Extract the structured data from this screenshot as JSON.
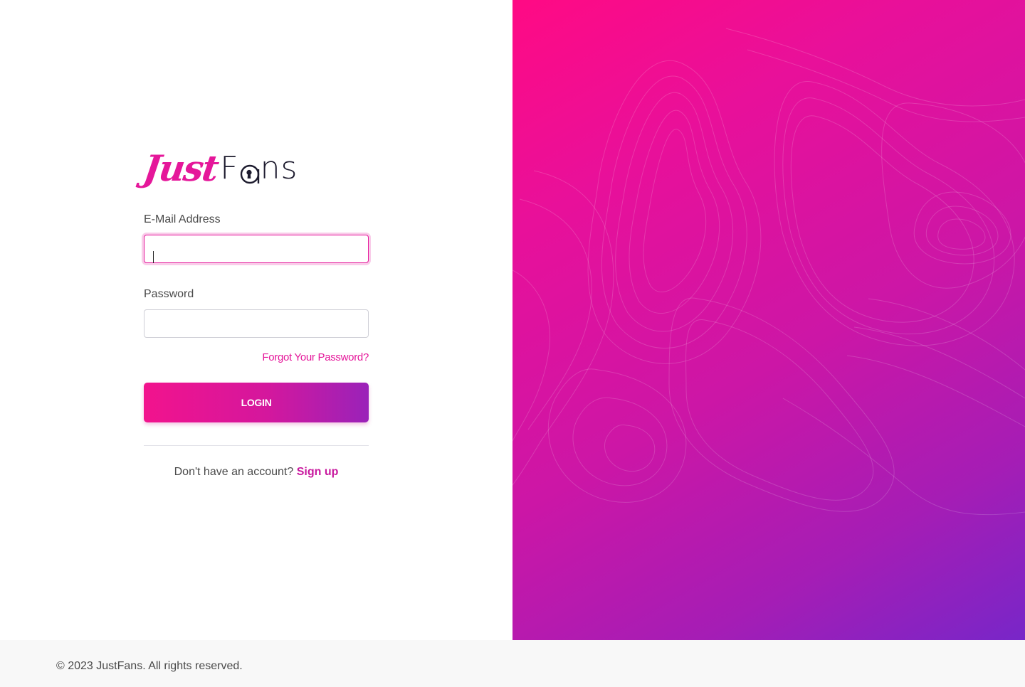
{
  "brand": {
    "logo_script": "Just",
    "logo_rest_pre": "F",
    "logo_rest_post": "ns",
    "accent_color": "#e5179a",
    "gradient_start": "#ff0a84",
    "gradient_end": "#7826c8"
  },
  "form": {
    "email_label": "E-Mail Address",
    "email_value": "",
    "password_label": "Password",
    "password_value": "",
    "forgot_password_label": "Forgot Your Password?",
    "login_button_label": "LOGIN",
    "signup_prompt": "Don't have an account?",
    "signup_link_label": "Sign up"
  },
  "footer": {
    "copyright": "© 2023 JustFans. All rights reserved."
  },
  "icons": {
    "logo_keyhole": "keyhole-icon"
  }
}
